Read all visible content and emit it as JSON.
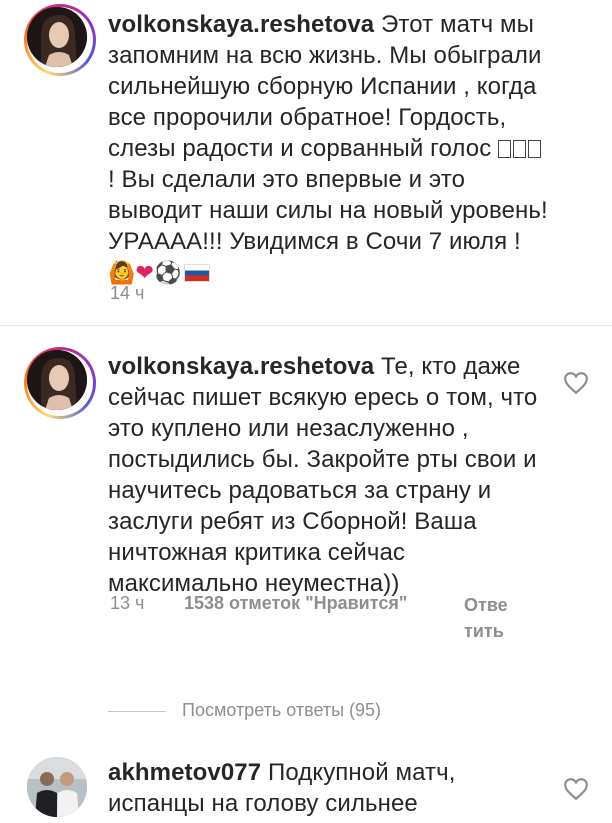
{
  "comments": [
    {
      "username": "volkonskaya.reshetova",
      "text": "Этот матч мы запомним на всю жизнь. Мы обыграли сильнейшую сборную Испании , когда все пророчили обратное! Гордость, слезы радости и сорванный голос",
      "text2": "! Вы сделали это впервые и это выводит наши силы на новый уровень! УРААAA!!! Увидимся в Сочи 7 июля !",
      "emoji_row": [
        "🙆",
        "❤",
        "⚽"
      ],
      "time": "14 ч"
    },
    {
      "username": "volkonskaya.reshetova",
      "text": "Те, кто даже сейчас пишет всякую ересь о том, что это куплено или незаслуженно , постыдились бы. Закройте рты свои и научитесь радоваться за страну и заслуги ребят из Сборной! Ваша ничтожная критика сейчас максимально неуместна))",
      "time": "13 ч",
      "likes": "1538 отметок \"Нравится\"",
      "reply": "Ответить",
      "view_replies": "Посмотреть ответы (95)"
    },
    {
      "username": "akhmetov077",
      "text": "Подкупной матч, испанцы на голову сильнее"
    }
  ],
  "icons": {
    "like": "heart-outline-icon"
  },
  "colors": {
    "text": "#262626",
    "meta": "#8e8e8e",
    "divider": "#e6e6e6"
  }
}
